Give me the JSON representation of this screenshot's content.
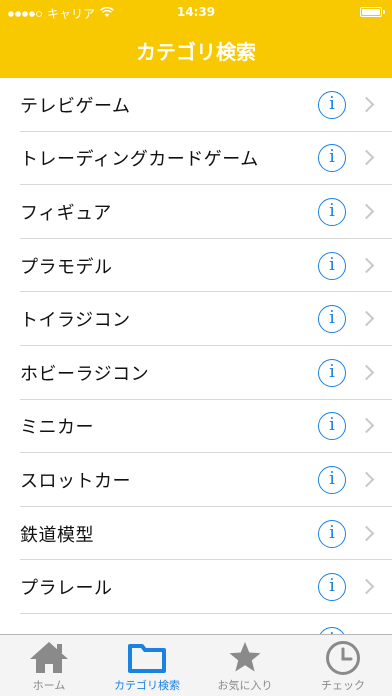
{
  "status_bar": {
    "carrier": "キャリア",
    "time": "14:39"
  },
  "nav": {
    "title": "カテゴリ検索"
  },
  "categories": [
    "テレビゲーム",
    "トレーディングカードゲーム",
    "フィギュア",
    "プラモデル",
    "トイラジコン",
    "ホビーラジコン",
    "ミニカー",
    "スロットカー",
    "鉄道模型",
    "プラレール"
  ],
  "info_glyph": "i",
  "tabs": [
    {
      "label": "ホーム",
      "icon": "home-icon"
    },
    {
      "label": "カテゴリ検索",
      "icon": "folder-icon",
      "active": true
    },
    {
      "label": "お気に入り",
      "icon": "star-icon"
    },
    {
      "label": "チェック",
      "icon": "clock-icon"
    }
  ],
  "colors": {
    "accent": "#f8c800",
    "link": "#1a82e2",
    "tab_inactive": "#8a8a8a"
  }
}
